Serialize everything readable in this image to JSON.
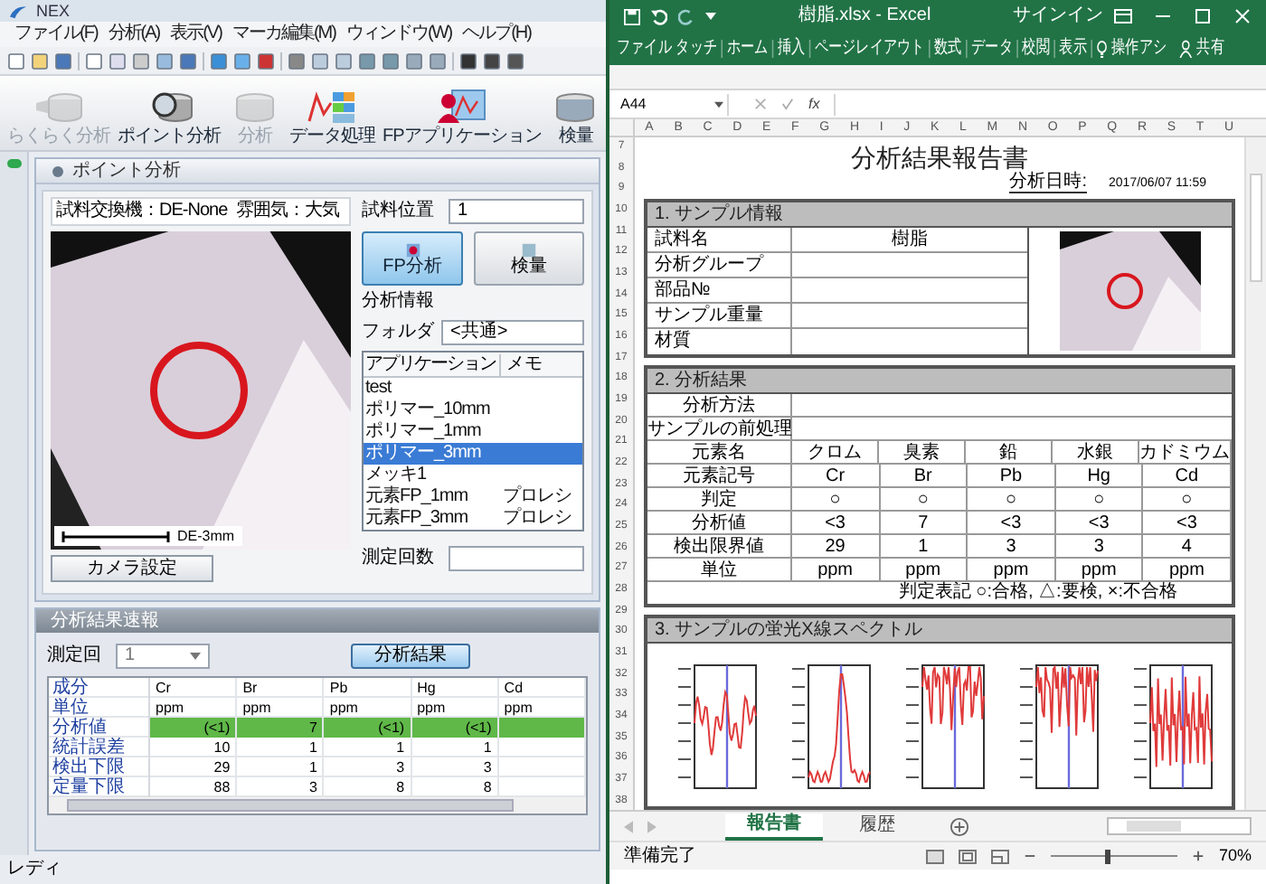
{
  "app": {
    "title": "NEX",
    "menu": [
      "ファイル(F)",
      "分析(A)",
      "表示(V)",
      "マーカ編集(M)",
      "ウィンドウ(W)",
      "ヘルプ(H)"
    ],
    "toolbar": [
      {
        "label": "らくらく分析",
        "disabled": true
      },
      {
        "label": "ポイント分析",
        "disabled": false
      },
      {
        "label": "分析",
        "disabled": true
      },
      {
        "label": "データ処理",
        "disabled": false
      },
      {
        "label": "FPアプリケーション",
        "disabled": false
      },
      {
        "label": "検量",
        "disabled": false
      }
    ],
    "point_analysis": {
      "title": "ポイント分析",
      "changer": "試料交換機：DE-None",
      "atmosphere": "雰囲気：大気",
      "position_label": "試料位置",
      "position_value": "1",
      "scale_label": "DE-3mm",
      "camera_button": "カメラ設定",
      "fp_button": "FP分析",
      "calibration_button": "検量",
      "info_label": "分析情報",
      "folder_label": "フォルダ",
      "folder_value": "<共通>",
      "list_columns": [
        "アプリケーション",
        "メモ"
      ],
      "applications": [
        {
          "name": "test",
          "selected": false
        },
        {
          "name": "ポリマー_10mm",
          "selected": false
        },
        {
          "name": "ポリマー_1mm",
          "selected": false
        },
        {
          "name": "ポリマー_3mm",
          "selected": true
        },
        {
          "name": "メッキ1",
          "selected": false
        },
        {
          "name": "元素FP_1mm",
          "memo": "プロレシ",
          "selected": false
        },
        {
          "name": "元素FP_3mm",
          "memo": "プロレシ",
          "selected": false
        }
      ],
      "count_label": "測定回数"
    },
    "results": {
      "title": "分析結果速報",
      "count_label": "測定回",
      "count_value": "1",
      "button": "分析結果",
      "rows": [
        {
          "label": "成分",
          "kind": "text",
          "highlighted": false,
          "cells": [
            "Cr",
            "Br",
            "Pb",
            "Hg",
            "Cd"
          ]
        },
        {
          "label": "単位",
          "kind": "text",
          "highlighted": false,
          "cells": [
            "ppm",
            "ppm",
            "ppm",
            "ppm",
            "ppm"
          ]
        },
        {
          "label": "分析値",
          "kind": "number",
          "highlighted": true,
          "cells": [
            "(<1)",
            "7",
            "(<1)",
            "(<1)"
          ]
        },
        {
          "label": "統計誤差",
          "kind": "number",
          "highlighted": false,
          "cells": [
            "10",
            "1",
            "1",
            "1"
          ]
        },
        {
          "label": "検出下限",
          "kind": "number",
          "highlighted": false,
          "cells": [
            "29",
            "1",
            "3",
            "3"
          ]
        },
        {
          "label": "定量下限",
          "kind": "number",
          "highlighted": false,
          "cells": [
            "88",
            "3",
            "8",
            "8"
          ]
        }
      ]
    },
    "status": "レディ"
  },
  "excel": {
    "title": "樹脂.xlsx - Excel",
    "sign_in": "サインイン",
    "ribbon_tabs": [
      "ファイル",
      "タッチ",
      "ホーム",
      "挿入",
      "ページレイアウト",
      "数式",
      "データ",
      "校閲",
      "表示"
    ],
    "tell_me": "操作アシ",
    "share": "共有",
    "name_box": "A44",
    "formula_label": "fx",
    "columns": [
      "A",
      "B",
      "C",
      "D",
      "E",
      "F",
      "G",
      "H",
      "I",
      "J",
      "K",
      "L",
      "M",
      "N",
      "O",
      "P",
      "Q",
      "R",
      "S",
      "T",
      "U"
    ],
    "rows": [
      "7",
      "8",
      "9",
      "10",
      "11",
      "12",
      "13",
      "14",
      "15",
      "16",
      "17",
      "18",
      "19",
      "20",
      "21",
      "22",
      "23",
      "24",
      "25",
      "26",
      "27",
      "28",
      "29",
      "30",
      "31",
      "32",
      "33",
      "34",
      "35",
      "36",
      "37",
      "38"
    ],
    "report": {
      "title": "分析結果報告書",
      "date_label": "分析日時:",
      "date_value": "2017/06/07 11:59",
      "sample_info": {
        "heading": "1. サンプル情報",
        "fields": [
          {
            "label": "試料名",
            "value": "樹脂"
          },
          {
            "label": "分析グループ"
          },
          {
            "label": "部品№"
          },
          {
            "label": "サンプル重量"
          },
          {
            "label": "材質"
          }
        ]
      },
      "results": {
        "heading": "2. 分析結果",
        "fields": [
          {
            "label": "分析方法"
          },
          {
            "label": "サンプルの前処理"
          }
        ],
        "rows": [
          {
            "label": "元素名",
            "cells": [
              "クロム",
              "臭素",
              "鉛",
              "水銀",
              "カドミウム"
            ]
          },
          {
            "label": "元素記号",
            "cells": [
              "Cr",
              "Br",
              "Pb",
              "Hg",
              "Cd"
            ]
          },
          {
            "label": "判定",
            "cells": [
              "○",
              "○",
              "○",
              "○",
              "○"
            ]
          },
          {
            "label": "分析値",
            "cells": [
              "<3",
              "7",
              "<3",
              "<3",
              "<3"
            ]
          },
          {
            "label": "検出限界値",
            "cells": [
              "29",
              "1",
              "3",
              "3",
              "4"
            ]
          },
          {
            "label": "単位",
            "cells": [
              "ppm",
              "ppm",
              "ppm",
              "ppm",
              "ppm"
            ]
          }
        ],
        "note": "判定表記 ○:合格, △:要検, ×:不合格"
      },
      "spectra": {
        "heading": "3. サンプルの蛍光X線スペクトル"
      }
    },
    "sheet_tabs": [
      {
        "label": "報告書",
        "selected": true
      },
      {
        "label": "履歴",
        "selected": false
      }
    ],
    "status": "準備完了",
    "zoom_slider": {
      "level": 0.45
    },
    "zoom": "70%"
  }
}
